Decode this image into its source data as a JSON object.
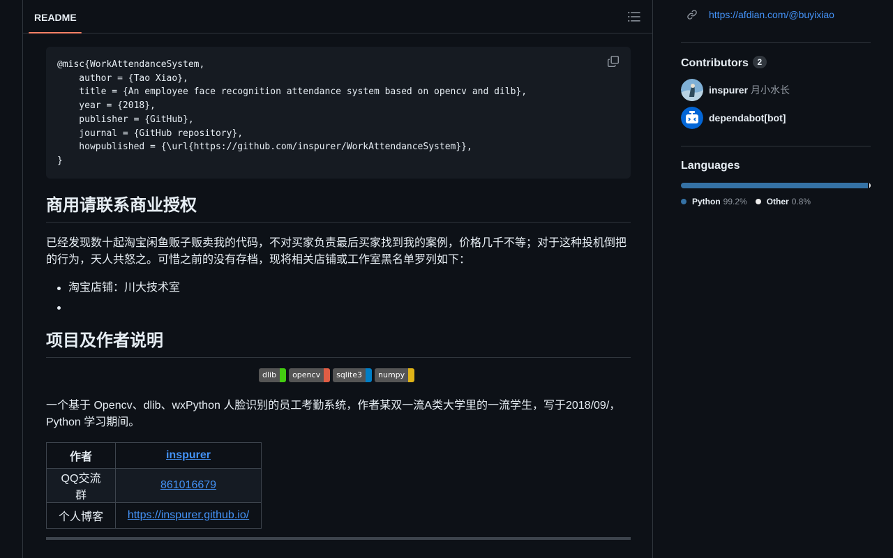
{
  "readme": {
    "tab_label": "README",
    "code_block": "@misc{WorkAttendanceSystem,\n    author = {Tao Xiao},\n    title = {An employee face recognition attendance system based on opencv and dilb},\n    year = {2018},\n    publisher = {GitHub},\n    journal = {GitHub repository},\n    howpublished = {\\url{https://github.com/inspurer/WorkAttendanceSystem}},\n}",
    "section_commercial": {
      "heading": "商用请联系商业授权",
      "paragraph": "已经发现数十起淘宝闲鱼贩子贩卖我的代码，不对买家负责最后买家找到我的案例，价格几千不等；对于这种投机倒把的行为，天人共怒之。可惜之前的没有存档，现将相关店铺或工作室黑名单罗列如下：",
      "list": [
        "淘宝店铺：川大技术室",
        ""
      ]
    },
    "section_project": {
      "heading": "项目及作者说明",
      "badges": [
        {
          "label": "dlib",
          "color": "#4c1"
        },
        {
          "label": "opencv",
          "color": "#e05d44"
        },
        {
          "label": "sqlite3",
          "color": "#007ec6"
        },
        {
          "label": "numpy",
          "color": "#dfb317"
        }
      ],
      "paragraph": "一个基于 Opencv、dlib、wxPython 人脸识别的员工考勤系统，作者某双一流A类大学里的一流学生，写于2018/09/，Python 学习期间。",
      "table": [
        {
          "key": "作者",
          "value": "inspurer"
        },
        {
          "key": "QQ交流群",
          "value": "861016679"
        },
        {
          "key": "个人博客",
          "value": "https://inspurer.github.io/"
        }
      ]
    }
  },
  "sidebar": {
    "sponsor_link": "https://afdian.com/@buyixiao",
    "contributors": {
      "title": "Contributors",
      "count": "2",
      "list": [
        {
          "login": "inspurer",
          "name": "月小水长"
        },
        {
          "login": "dependabot[bot]",
          "name": ""
        }
      ]
    },
    "languages": {
      "title": "Languages",
      "items": [
        {
          "name": "Python",
          "percent": "99.2%",
          "value": 99.2,
          "color": "#3572A5"
        },
        {
          "name": "Other",
          "percent": "0.8%",
          "value": 0.8,
          "color": "#ededed"
        }
      ]
    }
  }
}
